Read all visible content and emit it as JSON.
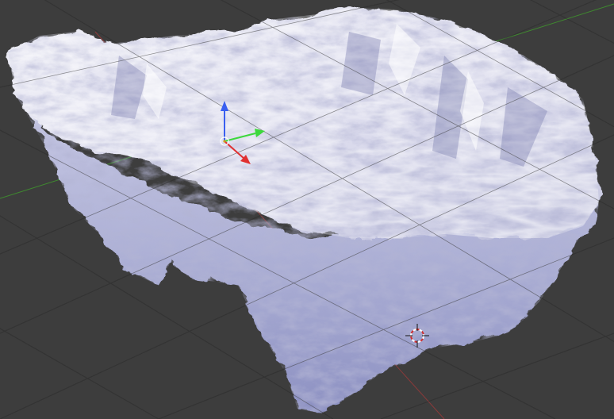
{
  "viewport": {
    "background_color": "#3d3d3d",
    "grid_color": "#2e2e2e",
    "grid_color_light": "#4a4a4a"
  },
  "axes": {
    "x_axis_color": "#8b3a3a",
    "y_axis_color": "#3f8a2f"
  },
  "mesh": {
    "name": "terrain",
    "base_color": "#c9cbe6",
    "shadow_color": "#7d82b8",
    "highlight_color": "#f2f2f7"
  },
  "manipulator": {
    "z_color": "#3a5ff0",
    "y_color": "#3cd83c",
    "x_color": "#e03030",
    "origin_color": "#ffffff"
  },
  "cursor_3d": {
    "ring_color_a": "#ffffff",
    "ring_color_b": "#d03030"
  }
}
